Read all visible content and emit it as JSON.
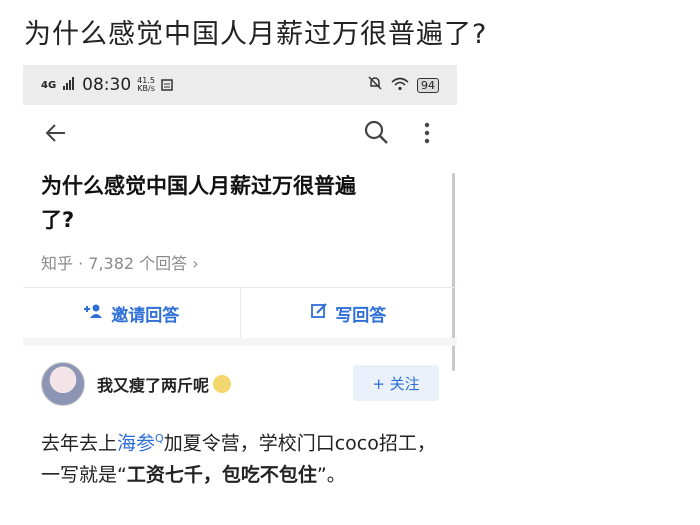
{
  "post": {
    "title": "为什么感觉中国人月薪过万很普遍了?"
  },
  "statusbar": {
    "network": "4G",
    "time": "08:30",
    "speed_value": "41.5",
    "speed_unit": "KB/s",
    "battery": "94"
  },
  "question": {
    "title_line1": "为什么感觉中国人月薪过万很普遍",
    "title_line2": "了?",
    "source": "知乎",
    "answer_count": "· 7,382 个回答 ›"
  },
  "actions": {
    "invite": "邀请回答",
    "write": "写回答"
  },
  "author": {
    "name": "我又瘦了两斤呢",
    "follow": "+ 关注"
  },
  "answer": {
    "part1": "去年去上",
    "link": "海参",
    "part2": "加夏令营，学校门口coco招工，一写就是“",
    "bold": "工资七千，包吃不包住",
    "part3": "”。"
  },
  "colors": {
    "accent": "#2e6fd8",
    "statusbar_bg": "#ececec"
  }
}
